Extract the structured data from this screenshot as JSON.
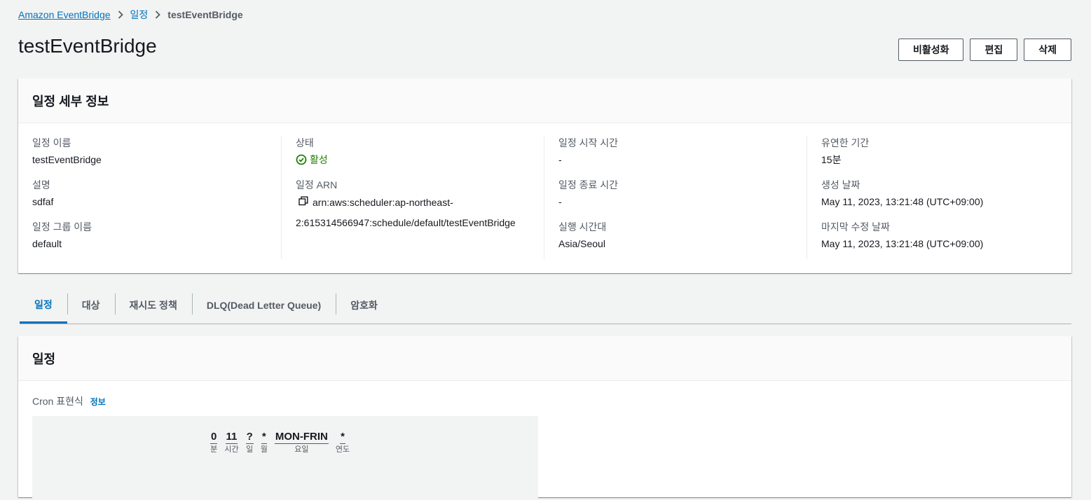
{
  "breadcrumb": {
    "root": "Amazon EventBridge",
    "section": "일정",
    "current": "testEventBridge"
  },
  "page": {
    "title": "testEventBridge"
  },
  "actions": {
    "disable": "비활성화",
    "edit": "편집",
    "delete": "삭제"
  },
  "details": {
    "header": "일정 세부 정보",
    "schedule_name_label": "일정 이름",
    "schedule_name": "testEventBridge",
    "description_label": "설명",
    "description": "sdfaf",
    "group_label": "일정 그룹 이름",
    "group": "default",
    "status_label": "상태",
    "status": "활성",
    "arn_label": "일정 ARN",
    "arn_line1": "arn:aws:scheduler:ap-northeast-",
    "arn_line2": "2:615314566947:schedule/default/testEventBridge",
    "start_label": "일정 시작 시간",
    "start": "-",
    "end_label": "일정 종료 시간",
    "end": "-",
    "timezone_label": "실행 시간대",
    "timezone": "Asia/Seoul",
    "window_label": "유연한 기간",
    "window": "15분",
    "created_label": "생성 날짜",
    "created": "May 11, 2023, 13:21:48 (UTC+09:00)",
    "modified_label": "마지막 수정 날짜",
    "modified": "May 11, 2023, 13:21:48 (UTC+09:00)"
  },
  "tabs": [
    "일정",
    "대상",
    "재시도 정책",
    "DLQ(Dead Letter Queue)",
    "암호화"
  ],
  "schedule": {
    "header": "일정",
    "cron_label": "Cron 표현식",
    "info_link": "정보",
    "cron": [
      {
        "value": "0",
        "unit": "분"
      },
      {
        "value": "11",
        "unit": "시간"
      },
      {
        "value": "?",
        "unit": "일"
      },
      {
        "value": "*",
        "unit": "월"
      },
      {
        "value": "MON-FRIN",
        "unit": "요일"
      },
      {
        "value": "*",
        "unit": "연도"
      }
    ]
  },
  "colors": {
    "link": "#0073bb",
    "success": "#1d8102",
    "background": "#f2f3f3"
  }
}
